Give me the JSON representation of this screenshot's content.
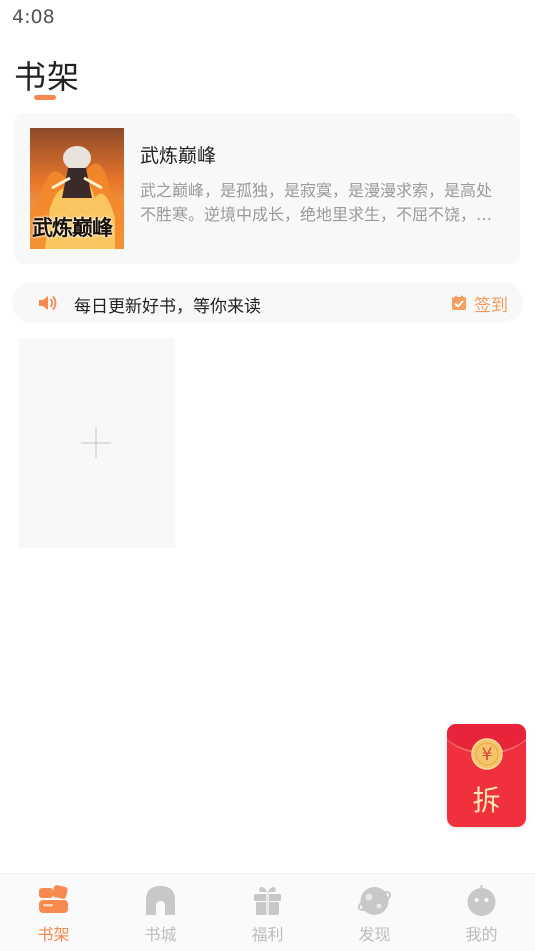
{
  "status": {
    "time": "4:08"
  },
  "header": {
    "title": "书架"
  },
  "featured_book": {
    "title": "武炼巅峰",
    "description": "武之巅峰，是孤独，是寂寞，是漫漫求索，是高处不胜寒。逆境中成长，绝地里求生，不屈不饶，才能堪破武之极道。",
    "cover_text": "武炼巅峰"
  },
  "notice": {
    "text": "每日更新好书，等你来读",
    "checkin_label": "签到",
    "speaker_icon": "speaker-icon",
    "checkin_icon": "checkbox-icon"
  },
  "shelf": {
    "add_icon": "plus-icon"
  },
  "redpacket": {
    "label": "拆",
    "coin_symbol": "¥"
  },
  "tabs": [
    {
      "label": "书架",
      "icon": "bookshelf-icon",
      "active": true
    },
    {
      "label": "书城",
      "icon": "bookstore-icon",
      "active": false
    },
    {
      "label": "福利",
      "icon": "gift-icon",
      "active": false
    },
    {
      "label": "发现",
      "icon": "discover-icon",
      "active": false
    },
    {
      "label": "我的",
      "icon": "profile-icon",
      "active": false
    }
  ],
  "colors": {
    "accent": "#f5894e",
    "inactive": "#bdbdbd",
    "redpacket": "#f0303d",
    "coin": "#f6c46b"
  }
}
